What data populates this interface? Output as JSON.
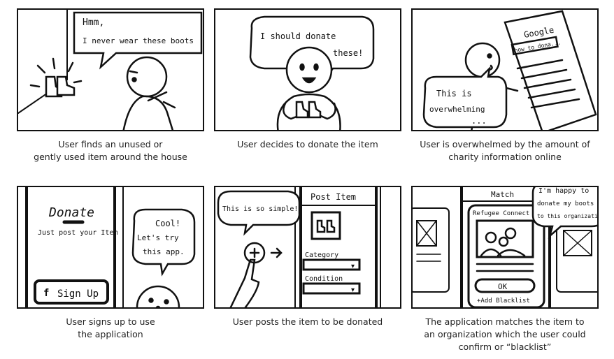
{
  "panels": [
    {
      "speech": [
        "Hmm,",
        "I never wear these boots"
      ],
      "caption": "User finds an unused or\ngently used item around the house"
    },
    {
      "speech": [
        "I should donate",
        "these!"
      ],
      "caption": "User decides to donate the item"
    },
    {
      "browser_title": "Google",
      "search_text": "how to dona...",
      "speech": [
        "This is",
        "overwhelming",
        "..."
      ],
      "caption": "User is overwhelmed by the amount of\ncharity information online"
    },
    {
      "app_title": "Donate",
      "app_subtitle": "Just post your Item",
      "signup_label": "Sign Up",
      "signup_icon": "f",
      "speech": [
        "Cool!",
        "Let's try",
        "this app."
      ],
      "caption": "User signs up to use\nthe application"
    },
    {
      "screen_title": "Post Item",
      "category_label": "Category",
      "condition_label": "Condition",
      "speech": [
        "This is so simple!"
      ],
      "caption": "User posts the item to be donated"
    },
    {
      "screen_title": "Match",
      "org_name": "Refugee Connect",
      "ok_label": "OK",
      "blacklist_label": "+Add Blacklist",
      "speech": [
        "I'm happy to",
        "donate my boots",
        "to this organization"
      ],
      "caption": "The application matches the item to\nan organization which the user could\nconfirm or “blacklist”"
    }
  ]
}
